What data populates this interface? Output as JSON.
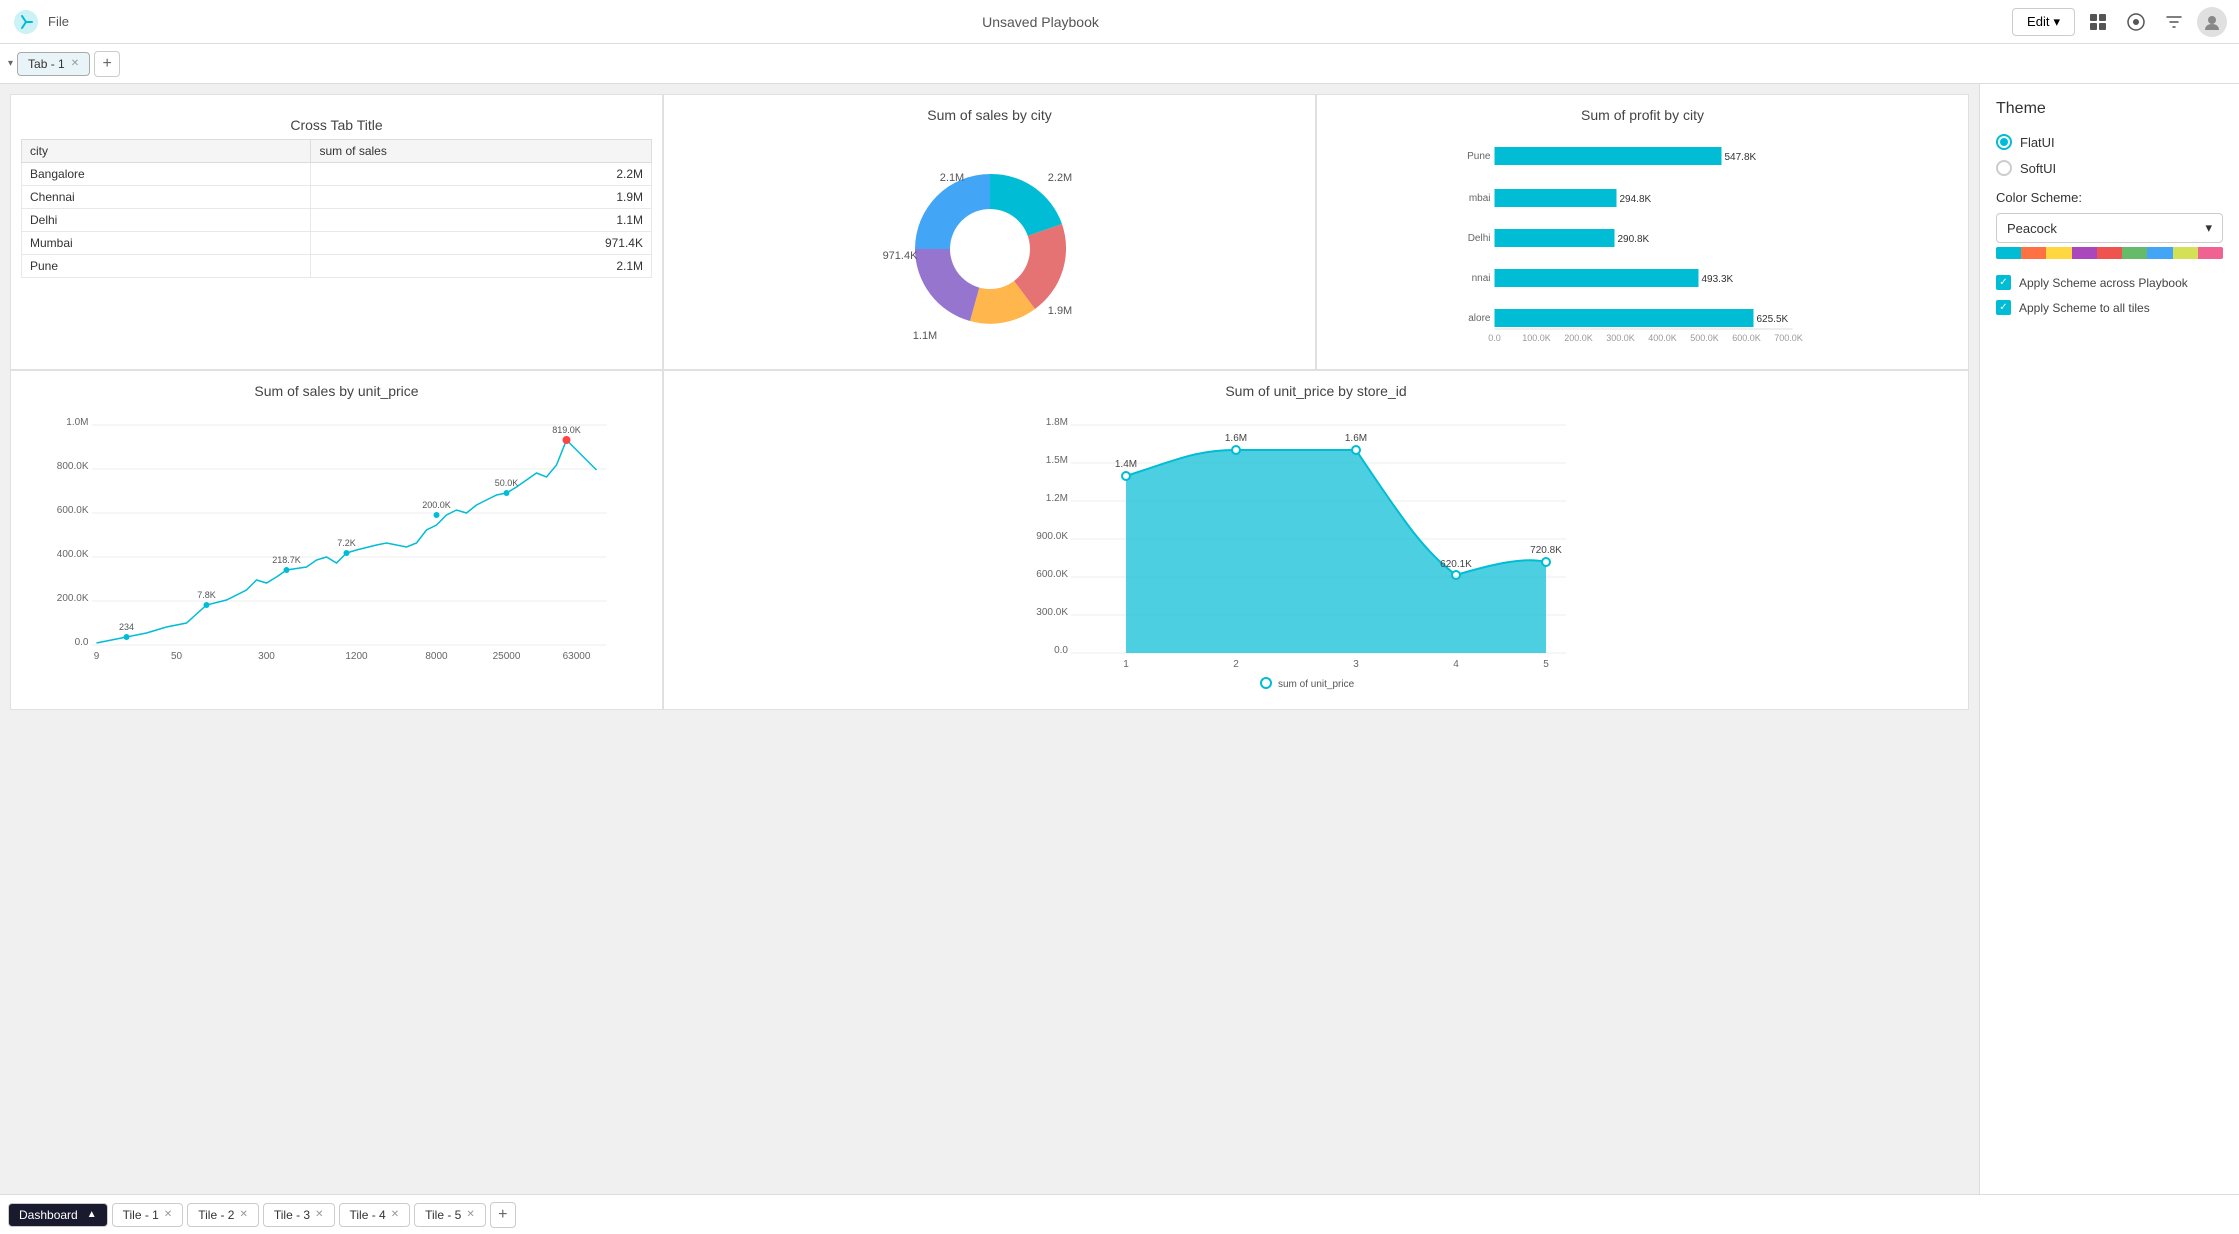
{
  "topbar": {
    "logo_alt": "ThoughtSpot logo",
    "title": "Unsaved Playbook",
    "edit_label": "Edit",
    "dropdown_icon": "▾"
  },
  "tab_bar": {
    "chevron": "▾",
    "tabs": [
      {
        "label": "Tab - 1",
        "active": true
      }
    ],
    "add_label": "+"
  },
  "tiles": {
    "crosstab": {
      "title": "Cross Tab Title",
      "columns": [
        "city",
        "sum of sales"
      ],
      "rows": [
        [
          "Bangalore",
          "2.2M"
        ],
        [
          "Chennai",
          "1.9M"
        ],
        [
          "Delhi",
          "1.1M"
        ],
        [
          "Mumbai",
          "971.4K"
        ],
        [
          "Pune",
          "2.1M"
        ]
      ]
    },
    "donut": {
      "title": "Sum of sales by city",
      "labels": [
        "2.1M",
        "2.2M",
        "1.9M",
        "1.1M",
        "971.4K"
      ],
      "positions": [
        "left-top",
        "right-top",
        "right-bottom",
        "bottom",
        "left-bottom"
      ]
    },
    "bar": {
      "title": "Sum of profit by city",
      "bars": [
        {
          "city": "Pune",
          "short": "Pune",
          "value": 547.8,
          "label": "547.8K"
        },
        {
          "city": "Mumbai",
          "short": "mbai",
          "value": 294.8,
          "label": "294.8K"
        },
        {
          "city": "Delhi",
          "short": "Delhi",
          "value": 290.8,
          "label": "290.8K"
        },
        {
          "city": "Chennai",
          "short": "nnai",
          "value": 493.3,
          "label": "493.3K"
        },
        {
          "city": "Bangalore",
          "short": "alore",
          "value": 625.5,
          "label": "625.5K"
        }
      ],
      "x_labels": [
        "0.0",
        "100.0K",
        "200.0K",
        "300.0K",
        "400.0K",
        "500.0K",
        "600.0K",
        "700.0K"
      ],
      "max_value": 700
    },
    "line": {
      "title": "Sum of sales by unit_price",
      "y_labels": [
        "1.0M",
        "800.0K",
        "600.0K",
        "400.0K",
        "200.0K",
        "0.0"
      ],
      "x_labels": [
        "9",
        "50",
        "300",
        "1200",
        "8000",
        "25000",
        "63000"
      ],
      "peak_labels": [
        "234",
        "7.8K",
        "218.7K",
        "7.2K",
        "200.0K",
        "50.0K",
        "819.0K"
      ]
    },
    "area": {
      "title": "Sum of unit_price by store_id",
      "y_labels": [
        "1.8M",
        "1.5M",
        "1.2M",
        "900.0K",
        "600.0K",
        "300.0K",
        "0.0"
      ],
      "x_labels": [
        "1",
        "2",
        "3",
        "4",
        "5"
      ],
      "point_labels": [
        "1.4M",
        "1.6M",
        "1.6M",
        "620.1K",
        "720.8K"
      ],
      "legend": "sum of unit_price"
    }
  },
  "right_panel": {
    "title": "Theme",
    "themes": [
      {
        "label": "FlatUI",
        "active": true
      },
      {
        "label": "SoftUI",
        "active": false
      }
    ],
    "color_scheme_label": "Color Scheme:",
    "color_scheme_value": "Peacock",
    "swatches": [
      "#00bcd4",
      "#ff7043",
      "#ffd740",
      "#ab47bc",
      "#ef5350",
      "#66bb6a",
      "#42a5f5",
      "#d4e157",
      "#f06292"
    ],
    "checkboxes": [
      {
        "label": "Apply Scheme across Playbook",
        "checked": true
      },
      {
        "label": "Apply Scheme to all tiles",
        "checked": true
      }
    ]
  },
  "bottom_tabs": {
    "tabs": [
      {
        "label": "Dashboard",
        "active": true,
        "closable": false
      },
      {
        "label": "Tile - 1",
        "active": false,
        "closable": true
      },
      {
        "label": "Tile - 2",
        "active": false,
        "closable": true
      },
      {
        "label": "Tile - 3",
        "active": false,
        "closable": true
      },
      {
        "label": "Tile - 4",
        "active": false,
        "closable": true
      },
      {
        "label": "Tile - 5",
        "active": false,
        "closable": true
      }
    ],
    "add_label": "+"
  }
}
